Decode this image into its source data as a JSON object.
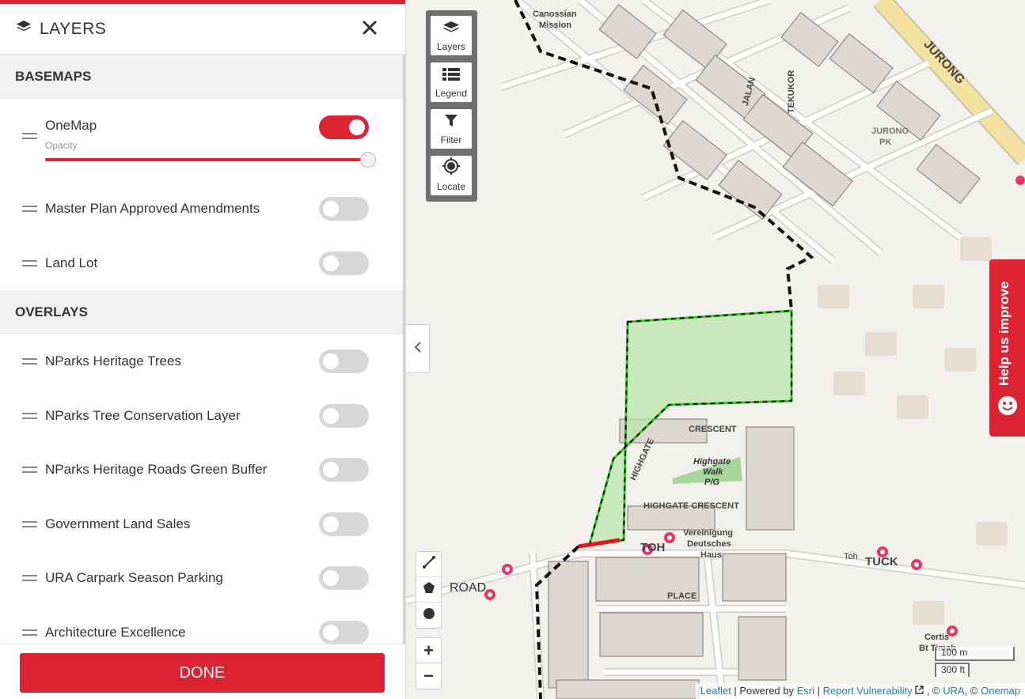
{
  "sidebar": {
    "title": "LAYERS",
    "basemaps_heading": "BASEMAPS",
    "basemaps": [
      {
        "label": "OneMap",
        "on": true,
        "opacity_label": "Opacity",
        "opacity": 1.0
      },
      {
        "label": "Master Plan Approved Amendments",
        "on": false
      },
      {
        "label": "Land Lot",
        "on": false
      }
    ],
    "overlays_heading": "OVERLAYS",
    "overlays": [
      {
        "label": "NParks Heritage Trees",
        "on": false
      },
      {
        "label": "NParks Tree Conservation Layer",
        "on": false
      },
      {
        "label": "NParks Heritage Roads Green Buffer",
        "on": false
      },
      {
        "label": "Government Land Sales",
        "on": false
      },
      {
        "label": "URA Carpark Season Parking",
        "on": false
      },
      {
        "label": "Architecture Excellence",
        "on": false
      }
    ],
    "done_label": "DONE"
  },
  "toolbar": {
    "layers": "Layers",
    "legend": "Legend",
    "filter": "Filter",
    "locate": "Locate"
  },
  "zoom": {
    "in": "+",
    "out": "−"
  },
  "help_tab": "Help us improve",
  "scale": {
    "metric": "100 m",
    "imperial": "300 ft"
  },
  "attribution": {
    "leaflet": "Leaflet",
    "powered_by": " | Powered by ",
    "esri": "Esri",
    "sep": " | ",
    "report": "Report Vulnerability",
    "copy1": " , © ",
    "ura": "URA",
    "copy2": ", © ",
    "onemap": "Onemap"
  },
  "map_labels": {
    "canossian": "Canossian",
    "mission": "Mission",
    "jurong": "JURONG",
    "jurong_pk": "JURONG",
    "pk": "PK",
    "crescent": "CRESCENT",
    "highgate": "HIGHGATE",
    "highgate_walk": "Highgate",
    "walk": "Walk",
    "pg": "P/G",
    "highgate_crescent": "HIGHGATE CRESCENT",
    "toh": "TOH",
    "tuck": "TUCK",
    "road": "ROAD",
    "toh_road": "Toh",
    "place": "PLACE",
    "verein1": "Vereinigung",
    "verein2": "Deutsches",
    "verein3": "Haus",
    "certis1": "Certis",
    "certis2": "Bt Timah",
    "jalan": "JALAN",
    "tekukor": "TEKUKOR"
  },
  "colors": {
    "accent": "#dc2331",
    "boundary": "#111111",
    "parcel": "#2ecc1a"
  }
}
